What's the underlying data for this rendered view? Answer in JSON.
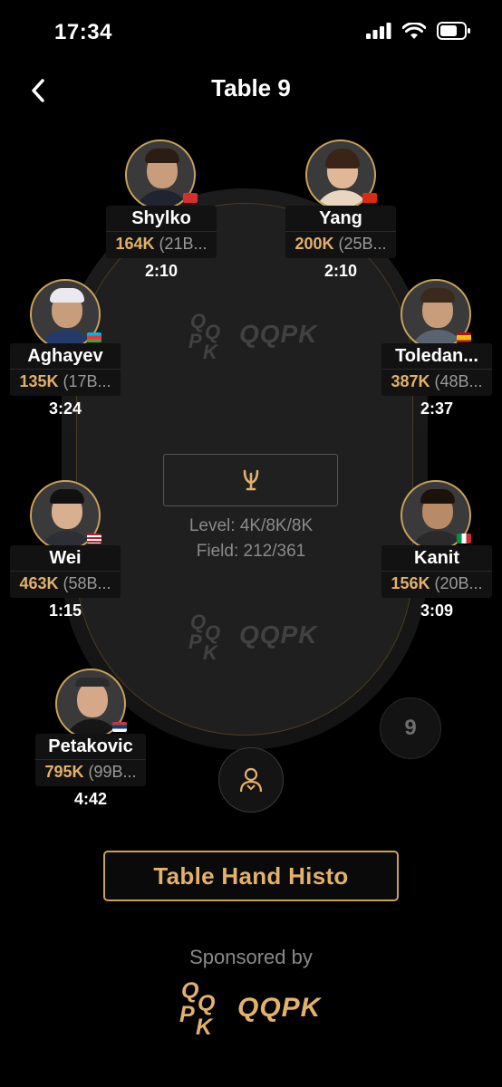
{
  "status": {
    "time": "17:34"
  },
  "nav": {
    "title": "Table 9",
    "back_icon": "chevron-left-icon"
  },
  "watermark": {
    "text": "QQPK",
    "mark": [
      "Q",
      "Q",
      "P",
      "K"
    ]
  },
  "center": {
    "trophy_icon": "trophy-icon",
    "level": "Level: 4K/8K/8K",
    "field": "Field: 212/361"
  },
  "seats": [
    {
      "name": "Shylko",
      "chips": "164K",
      "bb": " (21B...",
      "timer": "2:10",
      "flag_colors": [
        "#d32f2f",
        "#d32f2f"
      ]
    },
    {
      "name": "Yang",
      "chips": "200K",
      "bb": " (25B...",
      "timer": "2:10",
      "flag_colors": [
        "#de2910",
        "#ffde00"
      ]
    },
    {
      "name": "Aghayev",
      "chips": "135K",
      "bb": " (17B...",
      "timer": "3:24",
      "flag_colors": [
        "#00b5e2",
        "#ef3340",
        "#509e2f"
      ]
    },
    {
      "name": "Toledan...",
      "chips": "387K",
      "bb": " (48B...",
      "timer": "2:37",
      "flag_colors": [
        "#aa151b",
        "#f1bf00",
        "#aa151b"
      ]
    },
    {
      "name": "Wei",
      "chips": "463K",
      "bb": " (58B...",
      "timer": "1:15",
      "flag_colors": [
        "#b22234",
        "#ffffff",
        "#3c3b6e"
      ]
    },
    {
      "name": "Kanit",
      "chips": "156K",
      "bb": " (20B...",
      "timer": "3:09",
      "flag_colors": [
        "#009246",
        "#ffffff",
        "#ce2b37"
      ]
    },
    {
      "name": "Petakovic",
      "chips": "795K",
      "bb": " (99B...",
      "timer": "4:42",
      "flag_colors": [
        "#c6363c",
        "#0c4076",
        "#ffffff"
      ]
    }
  ],
  "seat_number": "9",
  "dealer_icon": "dealer-icon",
  "history_button": "Table Hand Histo",
  "sponsored": {
    "label": "Sponsored by",
    "logo_text": "QQPK",
    "logo_mark": [
      "Q",
      "Q",
      "P",
      "K"
    ]
  },
  "colors": {
    "gold": "#e2b16a",
    "gold_border": "#c9a25a",
    "muted": "#8a8a8a",
    "background": "#000000"
  }
}
